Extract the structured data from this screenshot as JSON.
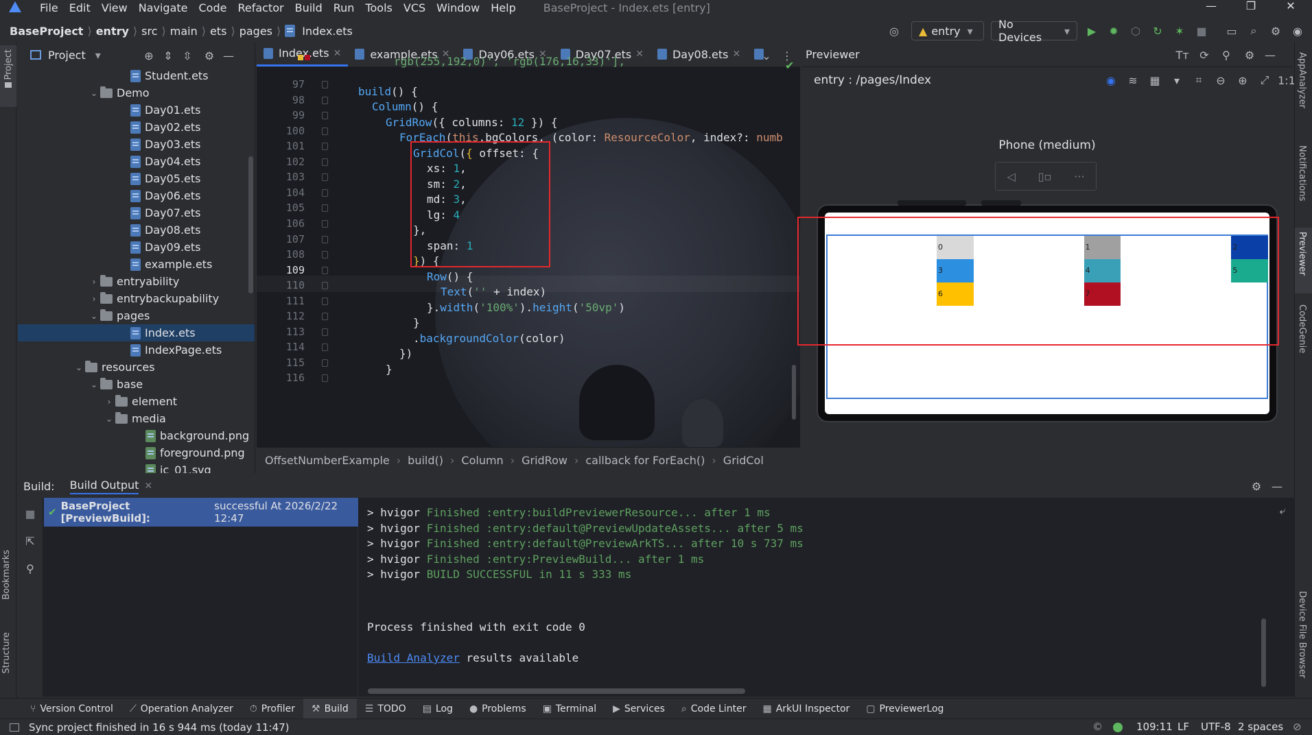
{
  "menubar": {
    "items": [
      "File",
      "Edit",
      "View",
      "Navigate",
      "Code",
      "Refactor",
      "Build",
      "Run",
      "Tools",
      "VCS",
      "Window",
      "Help"
    ],
    "title": "BaseProject - Index.ets [entry]",
    "controls": [
      "—",
      "❐",
      "✕"
    ]
  },
  "navbar": {
    "crumbs": [
      "BaseProject",
      "entry",
      "src",
      "main",
      "ets",
      "pages",
      "Index.ets"
    ],
    "run_config": "entry",
    "device": "No Devices"
  },
  "left_strip": {
    "project": "Project",
    "bookmarks": "Bookmarks",
    "structure": "Structure"
  },
  "project": {
    "title": "Project",
    "tree": [
      {
        "label": "Student.ets",
        "type": "file",
        "indent": 7,
        "arrow": ""
      },
      {
        "label": "Demo",
        "type": "folder",
        "indent": 5,
        "arrow": "⌄"
      },
      {
        "label": "Day01.ets",
        "type": "file",
        "indent": 7,
        "arrow": ""
      },
      {
        "label": "Day02.ets",
        "type": "file",
        "indent": 7,
        "arrow": ""
      },
      {
        "label": "Day03.ets",
        "type": "file",
        "indent": 7,
        "arrow": ""
      },
      {
        "label": "Day04.ets",
        "type": "file",
        "indent": 7,
        "arrow": ""
      },
      {
        "label": "Day05.ets",
        "type": "file",
        "indent": 7,
        "arrow": ""
      },
      {
        "label": "Day06.ets",
        "type": "file",
        "indent": 7,
        "arrow": ""
      },
      {
        "label": "Day07.ets",
        "type": "file",
        "indent": 7,
        "arrow": ""
      },
      {
        "label": "Day08.ets",
        "type": "file",
        "indent": 7,
        "arrow": ""
      },
      {
        "label": "Day09.ets",
        "type": "file",
        "indent": 7,
        "arrow": ""
      },
      {
        "label": "example.ets",
        "type": "file",
        "indent": 7,
        "arrow": ""
      },
      {
        "label": "entryability",
        "type": "folder",
        "indent": 5,
        "arrow": "›"
      },
      {
        "label": "entrybackupability",
        "type": "folder",
        "indent": 5,
        "arrow": "›"
      },
      {
        "label": "pages",
        "type": "folder",
        "indent": 5,
        "arrow": "⌄"
      },
      {
        "label": "Index.ets",
        "type": "file",
        "indent": 7,
        "arrow": "",
        "selected": true
      },
      {
        "label": "IndexPage.ets",
        "type": "file",
        "indent": 7,
        "arrow": ""
      },
      {
        "label": "resources",
        "type": "folder",
        "indent": 4,
        "arrow": "⌄"
      },
      {
        "label": "base",
        "type": "folder",
        "indent": 5,
        "arrow": "⌄"
      },
      {
        "label": "element",
        "type": "folder",
        "indent": 6,
        "arrow": "›"
      },
      {
        "label": "media",
        "type": "folder",
        "indent": 6,
        "arrow": "⌄"
      },
      {
        "label": "background.png",
        "type": "img",
        "indent": 8,
        "arrow": ""
      },
      {
        "label": "foreground.png",
        "type": "img",
        "indent": 8,
        "arrow": ""
      },
      {
        "label": "ic_01.svg",
        "type": "img",
        "indent": 8,
        "arrow": ""
      }
    ]
  },
  "editor": {
    "tabs": [
      {
        "label": "Index.ets",
        "active": true
      },
      {
        "label": "example.ets",
        "active": false
      },
      {
        "label": "Day06.ets",
        "active": false
      },
      {
        "label": "Day07.ets",
        "active": false
      },
      {
        "label": "Day08.ets",
        "active": false
      }
    ],
    "line_numbers": [
      "97",
      "98",
      "99",
      "100",
      "101",
      "102",
      "103",
      "104",
      "105",
      "106",
      "107",
      "108",
      "109",
      "110",
      "111",
      "112",
      "113",
      "114",
      "115",
      "116"
    ],
    "current_line": "109",
    "partial_top_line": "rgb(255,192,0)', 'rgb(176,16,33)'],",
    "breadcrumb": [
      "OffsetNumberExample",
      "build()",
      "Column",
      "GridRow",
      "callback for ForEach()",
      "GridCol"
    ]
  },
  "previewer": {
    "title": "Previewer",
    "route": "entry : /pages/Index",
    "device_name": "Phone (medium)",
    "cells": [
      {
        "label": "0",
        "color": "#d9d9d9"
      },
      {
        "label": "1",
        "color": "#a0a0a0"
      },
      {
        "label": "2",
        "color": "#0a3fa8"
      },
      {
        "label": "3",
        "color": "#2d8fe0"
      },
      {
        "label": "4",
        "color": "#3aa0b8"
      },
      {
        "label": "5",
        "color": "#1aaa8e"
      },
      {
        "label": "6",
        "color": "#ffc000"
      },
      {
        "label": "7",
        "color": "#b01021"
      }
    ],
    "highlight_color": "#e5282d"
  },
  "right_strip": {
    "items": [
      "AppAnalyzer",
      "Notifications",
      "Previewer",
      "CodeGenie",
      "Device File Browser"
    ]
  },
  "build": {
    "label": "Build:",
    "tab": "Build Output",
    "status_project": "BaseProject [PreviewBuild]:",
    "status_text": "successful At 2026/2/22 12:47",
    "output": [
      {
        "prefix": "> hvigor ",
        "text": "Finished :entry:buildPreviewerResource... after 1 ms"
      },
      {
        "prefix": "> hvigor ",
        "text": "Finished :entry:default@PreviewUpdateAssets... after 5 ms"
      },
      {
        "prefix": "> hvigor ",
        "text": "Finished :entry:default@PreviewArkTS... after 10 s 737 ms"
      },
      {
        "prefix": "> hvigor ",
        "text": "Finished :entry:PreviewBuild... after 1 ms"
      },
      {
        "prefix": "> hvigor ",
        "text": "BUILD SUCCESSFUL in 11 s 333 ms"
      }
    ],
    "exit_line": "Process finished with exit code 0",
    "analyzer_link": "Build Analyzer",
    "analyzer_rest": " results available"
  },
  "bottom_tools": [
    {
      "label": "Version Control",
      "glyph": "⑂"
    },
    {
      "label": "Operation Analyzer",
      "glyph": "⟋"
    },
    {
      "label": "Profiler",
      "glyph": "⏱"
    },
    {
      "label": "Build",
      "glyph": "⚒",
      "active": true
    },
    {
      "label": "TODO",
      "glyph": "☰"
    },
    {
      "label": "Log",
      "glyph": "▤"
    },
    {
      "label": "Problems",
      "glyph": "●"
    },
    {
      "label": "Terminal",
      "glyph": "▣"
    },
    {
      "label": "Services",
      "glyph": "▶"
    },
    {
      "label": "Code Linter",
      "glyph": "⌕"
    },
    {
      "label": "ArkUI Inspector",
      "glyph": "▦"
    },
    {
      "label": "PreviewerLog",
      "glyph": "▢"
    }
  ],
  "statusbar": {
    "message": "Sync project finished in 16 s 944 ms (today 11:47)",
    "position": "109:11",
    "line_ending": "LF",
    "encoding": "UTF-8",
    "indent": "2 spaces"
  }
}
